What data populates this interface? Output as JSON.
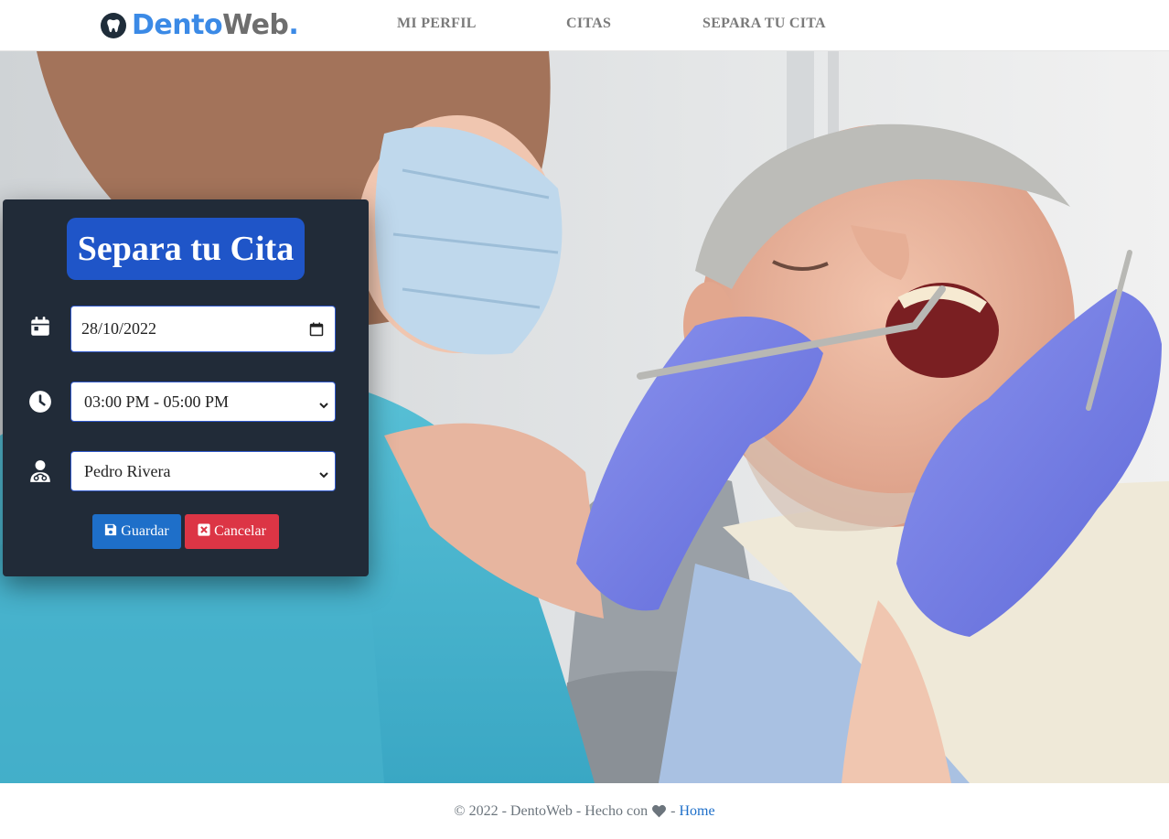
{
  "brand": {
    "name_part1": "Dento",
    "name_part2": "Web",
    "name_dot": ".",
    "logo_icon": "tooth-icon"
  },
  "nav": {
    "items": [
      {
        "label": "MI PERFIL"
      },
      {
        "label": "CITAS"
      },
      {
        "label": "SEPARA TU CITA"
      }
    ]
  },
  "form": {
    "title": "Separa tu Cita",
    "date": {
      "value": "28/10/2022",
      "icon": "calendar-icon"
    },
    "time": {
      "value": "03:00 PM - 05:00 PM",
      "icon": "clock-icon"
    },
    "doctor": {
      "value": "Pedro Rivera",
      "icon": "doctor-icon"
    },
    "save_label": "Guardar",
    "cancel_label": "Cancelar"
  },
  "footer": {
    "prefix": "© 2022 - DentoWeb - Hecho con",
    "separator": "-",
    "link_label": "Home"
  },
  "colors": {
    "accent": "#1f55c8",
    "brand_blue": "#3b8ae6",
    "card_bg": "#212b38",
    "save": "#1e6fc9",
    "cancel": "#dc3545"
  }
}
